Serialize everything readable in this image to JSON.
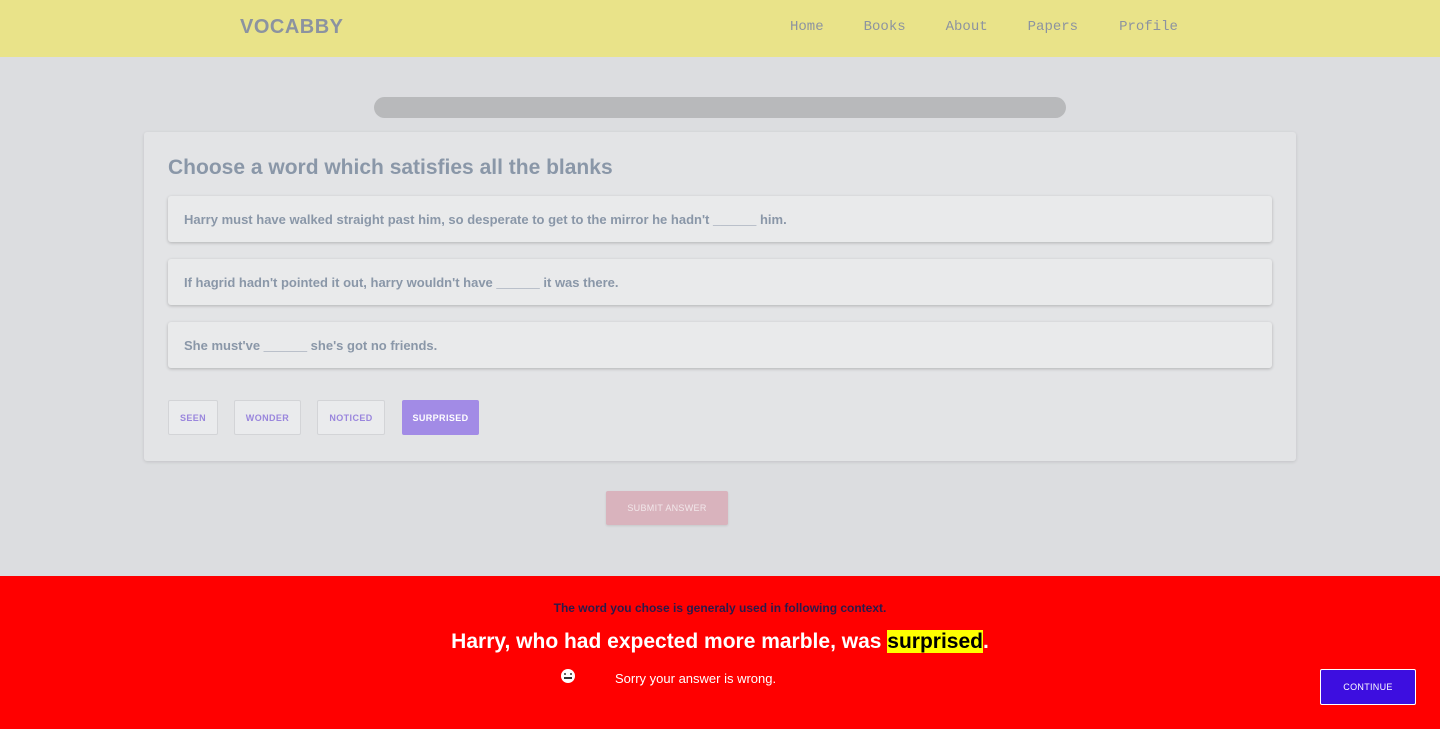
{
  "nav": {
    "brand": "VOCABBY",
    "links": [
      "Home",
      "Books",
      "About",
      "Papers",
      "Profile"
    ]
  },
  "progress": {
    "fraction": 0
  },
  "question": {
    "title": "Choose a word which satisfies all the blanks",
    "sentences": [
      "Harry must have walked straight past him, so desperate to get to the mirror he hadn't ______ him.",
      "If hagrid hadn't pointed it out, harry wouldn't have ______ it was there.",
      "She must've ______ she's got no friends."
    ],
    "options": [
      "SEEN",
      "WONDER",
      "NOTICED",
      "SURPRISED"
    ],
    "selected": "SURPRISED"
  },
  "submit_label": "SUBMIT ANSWER",
  "feedback": {
    "context_text": "The word you chose is generaly used in following context.",
    "example_before": "Harry, who had expected more marble, was ",
    "example_word": "surprised",
    "example_after": ".",
    "emoji_icon": "neutral-face-icon",
    "message": "Sorry your answer is wrong.",
    "continue_label": "CONTINUE",
    "background_color": "#ff0000"
  },
  "colors": {
    "navbar": "#e9e389",
    "selected_option": "#a28be6",
    "continue_button": "#3d0ee0"
  }
}
